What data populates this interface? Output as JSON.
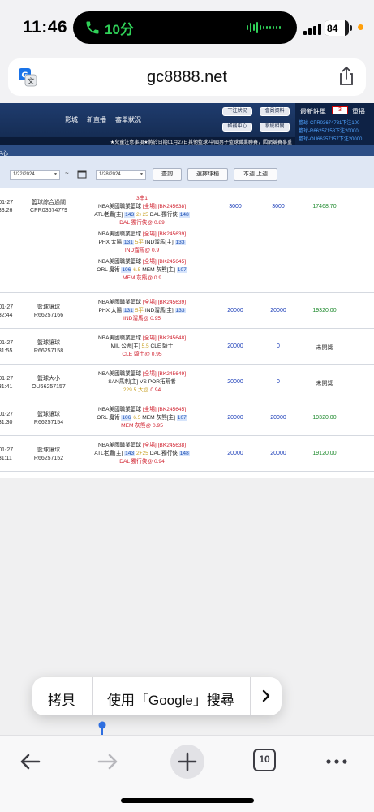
{
  "status": {
    "time": "11:46",
    "call_duration": "10分",
    "battery": "84",
    "battery_level": 0.84
  },
  "browser": {
    "url": "gc8888.net",
    "tab_count": "10"
  },
  "site": {
    "nav": [
      "影城",
      "新直播",
      "審單狀況"
    ],
    "header_buttons": [
      "下注狀況",
      "會員資料",
      "帳務中心",
      "系統相關"
    ],
    "latest": {
      "title": "最新註單",
      "count": "3",
      "reset": "重播",
      "lines": [
        "籃球-CPR03674781下注100",
        "籃球-R66257158下注20000",
        "籃球-OU66257157下注20000"
      ]
    },
    "marquee": "★兒童注意事項★將於日期01月27日其他籃球-中國男子籃球職業聯賽，因網競賽事重",
    "section_title": "中心",
    "filter": {
      "start_date": "1/22/2024",
      "tilde": "~",
      "end_date": "1/28/2024",
      "query": "查詢",
      "choose_sport": "選擇球種",
      "week_buttons": "本週 上週"
    }
  },
  "bets": [
    {
      "date": "4-01-27",
      "time": "3:33:26",
      "type": "籃球綜合過關",
      "id": "CPR03674779",
      "header": "3串1",
      "legs": [
        {
          "league": "NBA美國職業籃球",
          "tag": "[全場]",
          "code": "[BK245638]",
          "home": "ATL老鷹[主]",
          "hs": "143",
          "hc": "2+25",
          "away": "DAL 獨行俠",
          "as": "148",
          "pick": "DAL 獨行俠@",
          "odds": "0.89"
        },
        {
          "league": "NBA美國職業籃球",
          "tag": "[全場]",
          "code": "[BK245639]",
          "home": "PHX 太陽",
          "hs": "131",
          "hc": "5平",
          "away": "IND溜馬[主]",
          "as": "133",
          "pick": "IND溜馬@",
          "odds": "0.9"
        },
        {
          "league": "NBA美國職業籃球",
          "tag": "[全場]",
          "code": "[BK245645]",
          "home": "ORL 魔術",
          "hs": "106",
          "hc": "6.5",
          "away": "MEM 灰熊[主]",
          "as": "107",
          "pick": "MEM 灰熊@",
          "odds": "0.9"
        }
      ],
      "amount1": "3000",
      "amount2": "3000",
      "result": "17468.70"
    },
    {
      "date": "4-01-27",
      "time": "2:32:44",
      "type": "籃球讓球",
      "id": "R66257166",
      "legs": [
        {
          "league": "NBA美國職業籃球",
          "tag": "[全場]",
          "code": "[BK245639]",
          "home": "PHX 太陽",
          "hs": "131",
          "hc": "5平",
          "away": "IND溜馬[主]",
          "as": "133",
          "pick": "IND溜馬@",
          "odds": "0.95"
        }
      ],
      "amount1": "20000",
      "amount2": "20000",
      "result": "19320.00"
    },
    {
      "date": "4-01-27",
      "time": "2:31:55",
      "type": "籃球讓球",
      "id": "R66257158",
      "legs": [
        {
          "league": "NBA美國職業籃球",
          "tag": "[全場]",
          "code": "[BK245648]",
          "home": "MIL 公鹿[主]",
          "hs": "",
          "hc": "5.5",
          "away": "CLE 騎士",
          "as": "",
          "pick": "CLE 騎士@",
          "odds": "0.95"
        }
      ],
      "amount1": "20000",
      "amount2": "0",
      "result": "未開獎"
    },
    {
      "date": "4-01-27",
      "time": "2:31:41",
      "type": "籃球大小",
      "id": "OU66257157",
      "legs": [
        {
          "league": "NBA美國職業籃球",
          "tag": "[全場]",
          "code": "[BK245649]",
          "home": "SAN馬刺[主]",
          "hs": "",
          "hc": "",
          "away": "VS POR拓荒者",
          "as": "",
          "pick": "229.5 大@",
          "odds": "0.94"
        }
      ],
      "amount1": "20000",
      "amount2": "0",
      "result": "未開獎"
    },
    {
      "date": "4-01-27",
      "time": "2:31:30",
      "type": "籃球讓球",
      "id": "R66257154",
      "legs": [
        {
          "league": "NBA美國職業籃球",
          "tag": "[全場]",
          "code": "[BK245645]",
          "home": "ORL 魔術",
          "hs": "106",
          "hc": "6.5",
          "away": "MEM 灰熊[主]",
          "as": "107",
          "pick": "MEM 灰熊@",
          "odds": "0.95"
        }
      ],
      "amount1": "20000",
      "amount2": "20000",
      "result": "19320.00"
    },
    {
      "date": "4-01-27",
      "time": "2:31:11",
      "type": "籃球讓球",
      "id": "R66257152",
      "legs": [
        {
          "league": "NBA美國職業籃球",
          "tag": "[全場]",
          "code": "[BK245638]",
          "home": "ATL老鷹[主]",
          "hs": "143",
          "hc": "2+25",
          "away": "DAL 獨行俠",
          "as": "148",
          "pick": "DAL 獨行俠@",
          "odds": "0.94"
        }
      ],
      "amount1": "20000",
      "amount2": "20000",
      "result": "19120.00"
    }
  ],
  "context_menu": {
    "copy": "拷貝",
    "search": "使用「Google」搜尋"
  },
  "colors": {
    "header_bg": "#1f3c6e",
    "amount_blue": "#1a3db8",
    "win_green": "#1f8a2e",
    "accent_red": "#d0212e"
  }
}
